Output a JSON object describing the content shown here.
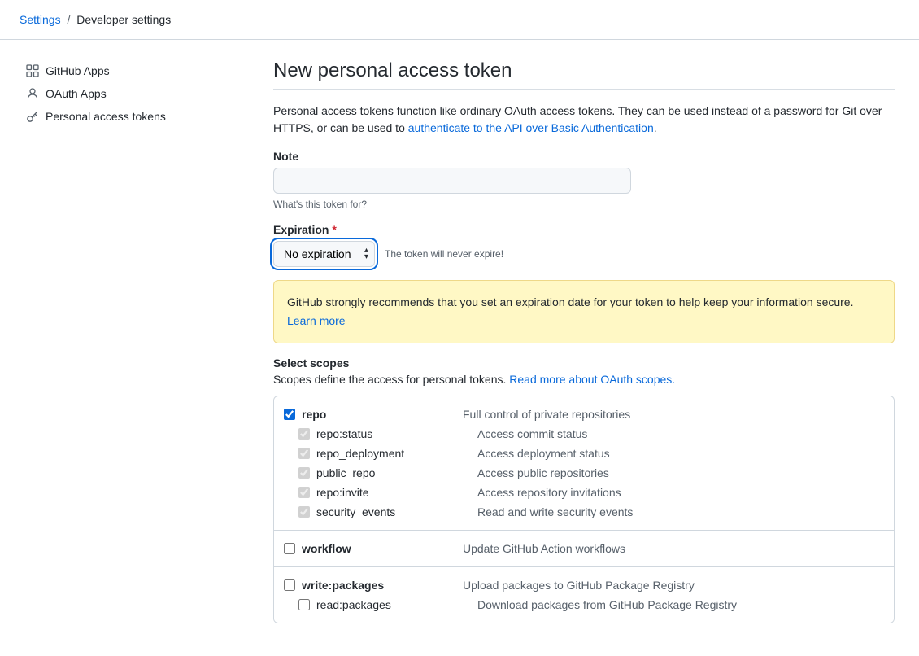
{
  "breadcrumb": {
    "settings": "Settings",
    "separator": "/",
    "current": "Developer settings"
  },
  "sidebar": {
    "items": [
      {
        "label": "GitHub Apps"
      },
      {
        "label": "OAuth Apps"
      },
      {
        "label": "Personal access tokens"
      }
    ]
  },
  "page": {
    "title": "New personal access token",
    "intro_before": "Personal access tokens function like ordinary OAuth access tokens. They can be used instead of a password for Git over HTTPS, or can be used to ",
    "intro_link": "authenticate to the API over Basic Authentication",
    "intro_after": "."
  },
  "note": {
    "label": "Note",
    "value": "",
    "hint": "What's this token for?"
  },
  "expiration": {
    "label": "Expiration",
    "value": "No expiration",
    "hint": "The token will never expire!"
  },
  "warning": {
    "text": "GitHub strongly recommends that you set an expiration date for your token to help keep your information secure.",
    "link": "Learn more"
  },
  "scopes": {
    "label": "Select scopes",
    "desc_before": "Scopes define the access for personal tokens. ",
    "desc_link": "Read more about OAuth scopes."
  },
  "scope_groups": [
    {
      "name": "repo",
      "desc": "Full control of private repositories",
      "checked": true,
      "disabled": false,
      "children": [
        {
          "name": "repo:status",
          "desc": "Access commit status",
          "checked": true,
          "disabled": true
        },
        {
          "name": "repo_deployment",
          "desc": "Access deployment status",
          "checked": true,
          "disabled": true
        },
        {
          "name": "public_repo",
          "desc": "Access public repositories",
          "checked": true,
          "disabled": true
        },
        {
          "name": "repo:invite",
          "desc": "Access repository invitations",
          "checked": true,
          "disabled": true
        },
        {
          "name": "security_events",
          "desc": "Read and write security events",
          "checked": true,
          "disabled": true
        }
      ]
    },
    {
      "name": "workflow",
      "desc": "Update GitHub Action workflows",
      "checked": false,
      "disabled": false,
      "children": []
    },
    {
      "name": "write:packages",
      "desc": "Upload packages to GitHub Package Registry",
      "checked": false,
      "disabled": false,
      "children": [
        {
          "name": "read:packages",
          "desc": "Download packages from GitHub Package Registry",
          "checked": false,
          "disabled": false
        }
      ]
    }
  ]
}
